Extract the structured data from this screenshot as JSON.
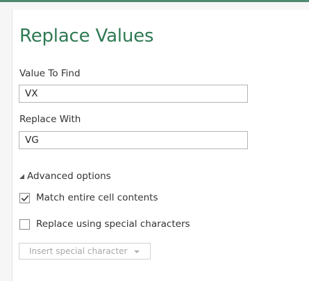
{
  "dialog": {
    "title": "Replace Values",
    "value_to_find": {
      "label": "Value To Find",
      "value": "VX"
    },
    "replace_with": {
      "label": "Replace With",
      "value": "VG"
    },
    "advanced_options": {
      "label": "Advanced options",
      "expanded": true,
      "icon": "triangle-expanded-icon"
    },
    "match_entire_cell": {
      "label": "Match entire cell contents",
      "checked": true
    },
    "replace_special_chars": {
      "label": "Replace using special characters",
      "checked": false
    },
    "insert_special_character": {
      "label": "Insert special character",
      "enabled": false,
      "icon": "chevron-down-icon"
    }
  },
  "colors": {
    "title": "#2f7a53",
    "accent_border": "#4f8a70",
    "disabled_text": "#a8a8a8"
  }
}
